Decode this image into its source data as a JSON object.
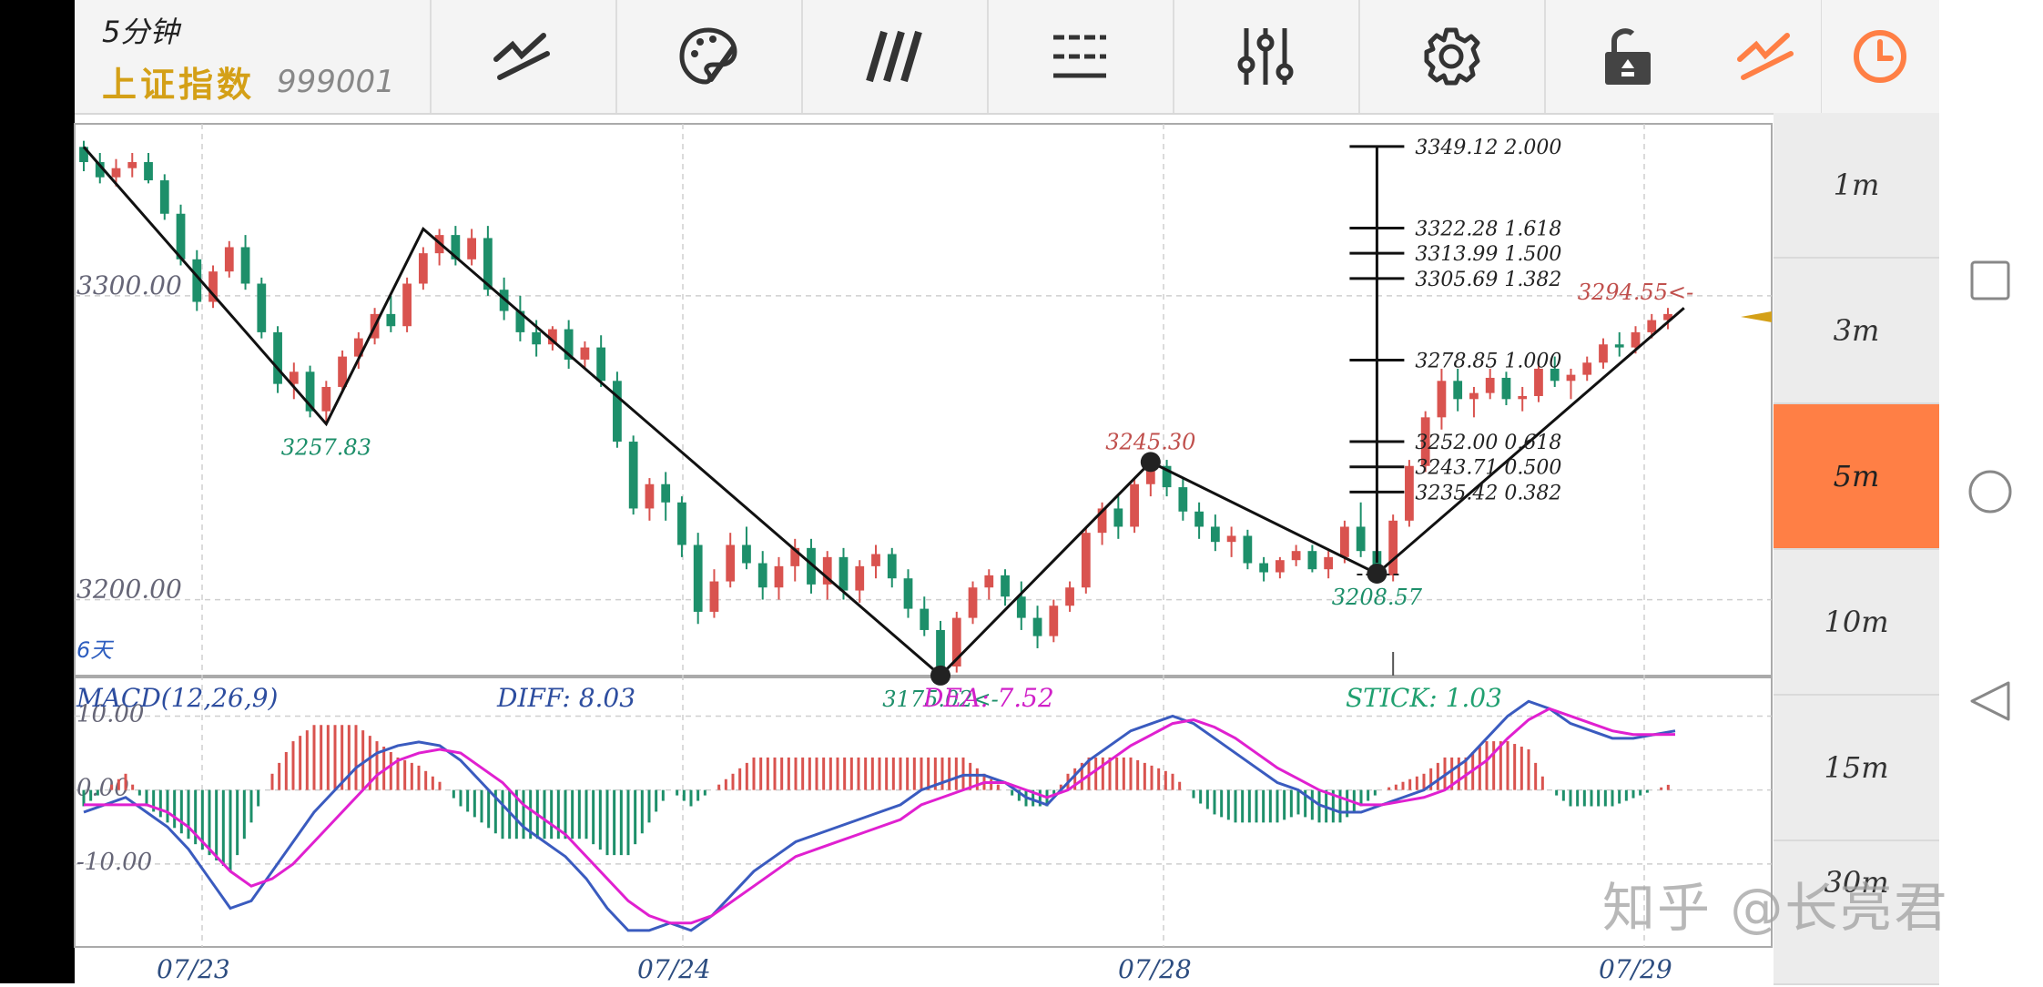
{
  "header": {
    "interval_label": "5分钟",
    "index_name": "上证指数",
    "index_code": "999001"
  },
  "toolbar": [
    {
      "name": "trend-line-tool",
      "icon": "trend-line-icon"
    },
    {
      "name": "palette-tool",
      "icon": "palette-icon"
    },
    {
      "name": "parallel-lines-tool",
      "icon": "parallel-lines-icon"
    },
    {
      "name": "horizontal-lines-tool",
      "icon": "horizontal-lines-icon"
    },
    {
      "name": "sliders-tool",
      "icon": "sliders-icon"
    },
    {
      "name": "settings-tool",
      "icon": "gear-icon"
    },
    {
      "name": "lock-tool",
      "icon": "unlock-icon"
    },
    {
      "name": "active-line-tool",
      "icon": "trend-line-icon"
    },
    {
      "name": "history-tool",
      "icon": "clock-icon"
    }
  ],
  "accent_color": "#ff7f45",
  "periods": [
    {
      "label": "1m",
      "active": false
    },
    {
      "label": "3m",
      "active": false
    },
    {
      "label": "5m",
      "active": true
    },
    {
      "label": "10m",
      "active": false
    },
    {
      "label": "15m",
      "active": false
    },
    {
      "label": "30m",
      "active": false
    }
  ],
  "watermark": "知乎 @长亮君",
  "chart_data": {
    "type": "candlestick",
    "x_tick_labels": [
      "07/23",
      "07/24",
      "07/28",
      "07/29"
    ],
    "price_axis_labels": [
      "3300.00",
      "3200.00"
    ],
    "price_range": [
      3175,
      3350
    ],
    "range_label": "6天",
    "up_color": "#d9534f",
    "down_color": "#1d8f6a",
    "candles": [
      {
        "o": 3349,
        "h": 3351,
        "l": 3341,
        "c": 3344
      },
      {
        "o": 3344,
        "h": 3347,
        "l": 3337,
        "c": 3339
      },
      {
        "o": 3339,
        "h": 3345,
        "l": 3336,
        "c": 3342
      },
      {
        "o": 3342,
        "h": 3347,
        "l": 3339,
        "c": 3344
      },
      {
        "o": 3344,
        "h": 3347,
        "l": 3337,
        "c": 3338
      },
      {
        "o": 3338,
        "h": 3340,
        "l": 3325,
        "c": 3327
      },
      {
        "o": 3327,
        "h": 3330,
        "l": 3310,
        "c": 3312
      },
      {
        "o": 3312,
        "h": 3315,
        "l": 3295,
        "c": 3298
      },
      {
        "o": 3298,
        "h": 3310,
        "l": 3296,
        "c": 3308
      },
      {
        "o": 3308,
        "h": 3318,
        "l": 3306,
        "c": 3316
      },
      {
        "o": 3316,
        "h": 3320,
        "l": 3302,
        "c": 3304
      },
      {
        "o": 3304,
        "h": 3306,
        "l": 3286,
        "c": 3288
      },
      {
        "o": 3288,
        "h": 3290,
        "l": 3268,
        "c": 3271
      },
      {
        "o": 3271,
        "h": 3278,
        "l": 3266,
        "c": 3275
      },
      {
        "o": 3275,
        "h": 3277,
        "l": 3260,
        "c": 3262
      },
      {
        "o": 3262,
        "h": 3272,
        "l": 3258,
        "c": 3270
      },
      {
        "o": 3270,
        "h": 3282,
        "l": 3268,
        "c": 3280
      },
      {
        "o": 3280,
        "h": 3288,
        "l": 3276,
        "c": 3286
      },
      {
        "o": 3286,
        "h": 3296,
        "l": 3284,
        "c": 3294
      },
      {
        "o": 3294,
        "h": 3300,
        "l": 3288,
        "c": 3290
      },
      {
        "o": 3290,
        "h": 3306,
        "l": 3288,
        "c": 3304
      },
      {
        "o": 3304,
        "h": 3316,
        "l": 3302,
        "c": 3314
      },
      {
        "o": 3314,
        "h": 3322,
        "l": 3310,
        "c": 3320
      },
      {
        "o": 3320,
        "h": 3323,
        "l": 3310,
        "c": 3312
      },
      {
        "o": 3312,
        "h": 3322,
        "l": 3310,
        "c": 3319
      },
      {
        "o": 3319,
        "h": 3323,
        "l": 3300,
        "c": 3302
      },
      {
        "o": 3302,
        "h": 3306,
        "l": 3292,
        "c": 3295
      },
      {
        "o": 3295,
        "h": 3300,
        "l": 3285,
        "c": 3288
      },
      {
        "o": 3288,
        "h": 3292,
        "l": 3280,
        "c": 3284
      },
      {
        "o": 3284,
        "h": 3290,
        "l": 3282,
        "c": 3289
      },
      {
        "o": 3289,
        "h": 3292,
        "l": 3276,
        "c": 3279
      },
      {
        "o": 3279,
        "h": 3285,
        "l": 3276,
        "c": 3283
      },
      {
        "o": 3283,
        "h": 3287,
        "l": 3270,
        "c": 3272
      },
      {
        "o": 3272,
        "h": 3275,
        "l": 3250,
        "c": 3252
      },
      {
        "o": 3252,
        "h": 3254,
        "l": 3228,
        "c": 3230
      },
      {
        "o": 3230,
        "h": 3240,
        "l": 3226,
        "c": 3238
      },
      {
        "o": 3238,
        "h": 3242,
        "l": 3226,
        "c": 3232
      },
      {
        "o": 3232,
        "h": 3234,
        "l": 3214,
        "c": 3218
      },
      {
        "o": 3218,
        "h": 3222,
        "l": 3192,
        "c": 3196
      },
      {
        "o": 3196,
        "h": 3210,
        "l": 3194,
        "c": 3206
      },
      {
        "o": 3206,
        "h": 3222,
        "l": 3204,
        "c": 3218
      },
      {
        "o": 3218,
        "h": 3224,
        "l": 3210,
        "c": 3212
      },
      {
        "o": 3212,
        "h": 3216,
        "l": 3200,
        "c": 3204
      },
      {
        "o": 3204,
        "h": 3214,
        "l": 3200,
        "c": 3211
      },
      {
        "o": 3211,
        "h": 3220,
        "l": 3206,
        "c": 3217
      },
      {
        "o": 3217,
        "h": 3220,
        "l": 3202,
        "c": 3205
      },
      {
        "o": 3205,
        "h": 3216,
        "l": 3200,
        "c": 3214
      },
      {
        "o": 3214,
        "h": 3217,
        "l": 3200,
        "c": 3203
      },
      {
        "o": 3203,
        "h": 3213,
        "l": 3199,
        "c": 3211
      },
      {
        "o": 3211,
        "h": 3218,
        "l": 3207,
        "c": 3215
      },
      {
        "o": 3215,
        "h": 3217,
        "l": 3204,
        "c": 3207
      },
      {
        "o": 3207,
        "h": 3210,
        "l": 3194,
        "c": 3197
      },
      {
        "o": 3197,
        "h": 3201,
        "l": 3188,
        "c": 3190
      },
      {
        "o": 3190,
        "h": 3193,
        "l": 3176,
        "c": 3178
      },
      {
        "o": 3178,
        "h": 3196,
        "l": 3176,
        "c": 3194
      },
      {
        "o": 3194,
        "h": 3206,
        "l": 3192,
        "c": 3204
      },
      {
        "o": 3204,
        "h": 3210,
        "l": 3200,
        "c": 3208
      },
      {
        "o": 3208,
        "h": 3210,
        "l": 3198,
        "c": 3201
      },
      {
        "o": 3201,
        "h": 3206,
        "l": 3190,
        "c": 3194
      },
      {
        "o": 3194,
        "h": 3198,
        "l": 3184,
        "c": 3188
      },
      {
        "o": 3188,
        "h": 3200,
        "l": 3186,
        "c": 3198
      },
      {
        "o": 3198,
        "h": 3206,
        "l": 3196,
        "c": 3204
      },
      {
        "o": 3204,
        "h": 3224,
        "l": 3202,
        "c": 3222
      },
      {
        "o": 3222,
        "h": 3232,
        "l": 3218,
        "c": 3230
      },
      {
        "o": 3230,
        "h": 3234,
        "l": 3220,
        "c": 3224
      },
      {
        "o": 3224,
        "h": 3240,
        "l": 3222,
        "c": 3238
      },
      {
        "o": 3238,
        "h": 3247,
        "l": 3234,
        "c": 3244
      },
      {
        "o": 3244,
        "h": 3246,
        "l": 3234,
        "c": 3237
      },
      {
        "o": 3237,
        "h": 3240,
        "l": 3226,
        "c": 3229
      },
      {
        "o": 3229,
        "h": 3232,
        "l": 3220,
        "c": 3224
      },
      {
        "o": 3224,
        "h": 3228,
        "l": 3216,
        "c": 3219
      },
      {
        "o": 3219,
        "h": 3224,
        "l": 3214,
        "c": 3221
      },
      {
        "o": 3221,
        "h": 3223,
        "l": 3210,
        "c": 3212
      },
      {
        "o": 3212,
        "h": 3214,
        "l": 3206,
        "c": 3209
      },
      {
        "o": 3209,
        "h": 3214,
        "l": 3207,
        "c": 3213
      },
      {
        "o": 3213,
        "h": 3218,
        "l": 3211,
        "c": 3216
      },
      {
        "o": 3216,
        "h": 3218,
        "l": 3209,
        "c": 3210
      },
      {
        "o": 3210,
        "h": 3216,
        "l": 3207,
        "c": 3214
      },
      {
        "o": 3214,
        "h": 3226,
        "l": 3212,
        "c": 3224
      },
      {
        "o": 3224,
        "h": 3232,
        "l": 3214,
        "c": 3216
      },
      {
        "o": 3216,
        "h": 3218,
        "l": 3206,
        "c": 3208
      },
      {
        "o": 3208,
        "h": 3228,
        "l": 3206,
        "c": 3226
      },
      {
        "o": 3226,
        "h": 3246,
        "l": 3224,
        "c": 3244
      },
      {
        "o": 3244,
        "h": 3262,
        "l": 3242,
        "c": 3260
      },
      {
        "o": 3260,
        "h": 3276,
        "l": 3256,
        "c": 3272
      },
      {
        "o": 3272,
        "h": 3276,
        "l": 3262,
        "c": 3266
      },
      {
        "o": 3266,
        "h": 3270,
        "l": 3260,
        "c": 3268
      },
      {
        "o": 3268,
        "h": 3276,
        "l": 3266,
        "c": 3273
      },
      {
        "o": 3273,
        "h": 3275,
        "l": 3264,
        "c": 3266
      },
      {
        "o": 3266,
        "h": 3270,
        "l": 3262,
        "c": 3267
      },
      {
        "o": 3267,
        "h": 3278,
        "l": 3265,
        "c": 3276
      },
      {
        "o": 3276,
        "h": 3280,
        "l": 3270,
        "c": 3272
      },
      {
        "o": 3272,
        "h": 3276,
        "l": 3266,
        "c": 3274
      },
      {
        "o": 3274,
        "h": 3280,
        "l": 3272,
        "c": 3278
      },
      {
        "o": 3278,
        "h": 3286,
        "l": 3276,
        "c": 3284
      },
      {
        "o": 3284,
        "h": 3288,
        "l": 3280,
        "c": 3283
      },
      {
        "o": 3283,
        "h": 3290,
        "l": 3281,
        "c": 3288
      },
      {
        "o": 3288,
        "h": 3294,
        "l": 3286,
        "c": 3292
      },
      {
        "o": 3292,
        "h": 3296,
        "l": 3289,
        "c": 3294
      }
    ],
    "zigzag_points": [
      {
        "i": 0,
        "price": 3349
      },
      {
        "i": 15,
        "price": 3257.83
      },
      {
        "i": 21,
        "price": 3322
      },
      {
        "i": 53,
        "price": 3175.02
      },
      {
        "i": 66,
        "price": 3245.3
      },
      {
        "i": 80,
        "price": 3208.57
      },
      {
        "i": 99,
        "price": 3296
      }
    ],
    "pivot_labels": [
      {
        "i": 15,
        "price": 3257.83,
        "text": "3257.83",
        "color": "#1d8f6a",
        "pos": "below"
      },
      {
        "i": 53,
        "price": 3175.02,
        "text": "3175.02<-",
        "color": "#1d8f6a",
        "pos": "below"
      },
      {
        "i": 66,
        "price": 3245.3,
        "text": "3245.30",
        "color": "#c0504d",
        "pos": "above"
      },
      {
        "i": 80,
        "price": 3208.57,
        "text": "3208.57",
        "color": "#1d8f6a",
        "pos": "below"
      },
      {
        "i": 96,
        "price": 3294.55,
        "text": "3294.55<-",
        "color": "#c0504d",
        "pos": "above"
      }
    ],
    "fibonacci": {
      "levels": [
        {
          "price": 3349.12,
          "ratio": "2.000"
        },
        {
          "price": 3322.28,
          "ratio": "1.618"
        },
        {
          "price": 3313.99,
          "ratio": "1.500"
        },
        {
          "price": 3305.69,
          "ratio": "1.382"
        },
        {
          "price": 3278.85,
          "ratio": "1.000"
        },
        {
          "price": 3252.0,
          "ratio": "0.618"
        },
        {
          "price": 3243.71,
          "ratio": "0.500"
        },
        {
          "price": 3235.42,
          "ratio": "0.382"
        }
      ]
    },
    "macd": {
      "label": "MACD(12,26,9)",
      "diff_label": "DIFF: 8.03",
      "dea_label": "DEA: 7.52",
      "stick_label": "STICK: 1.03",
      "axis_labels": [
        "10.00",
        "0.00",
        "-10.00"
      ],
      "range": [
        -20,
        14
      ],
      "diff_color": "#3a5bbf",
      "dea_color": "#e020d0",
      "diff": [
        -3,
        -2,
        -1,
        -3,
        -5,
        -8,
        -12,
        -16,
        -15,
        -11,
        -7,
        -3,
        0,
        3,
        5,
        6,
        6.5,
        6,
        4,
        1,
        -2,
        -5,
        -7,
        -9,
        -12,
        -16,
        -19,
        -19,
        -18,
        -19,
        -17,
        -14,
        -11,
        -9,
        -7,
        -6,
        -5,
        -4,
        -3,
        -2,
        0,
        1,
        2,
        2,
        1,
        -1,
        -2,
        1,
        4,
        6,
        8,
        9,
        10,
        9,
        7,
        5,
        3,
        1,
        0,
        -2,
        -3,
        -3,
        -2,
        -1,
        0,
        2,
        4,
        7,
        10,
        12,
        11,
        9,
        8,
        7,
        7,
        7.5,
        8
      ],
      "dea": [
        -2,
        -2,
        -2,
        -2,
        -3,
        -5,
        -8,
        -11,
        -13,
        -12,
        -10,
        -7,
        -4,
        -1,
        2,
        4,
        5,
        5.5,
        5,
        3,
        1,
        -2,
        -4,
        -6,
        -9,
        -12,
        -15,
        -17,
        -18,
        -18,
        -17,
        -15,
        -13,
        -11,
        -9,
        -8,
        -7,
        -6,
        -5,
        -4,
        -2,
        -1,
        0,
        1,
        1,
        0,
        -1,
        0,
        2,
        4,
        6,
        7.5,
        9,
        9.5,
        8.5,
        7,
        5,
        3,
        1.5,
        0,
        -1,
        -2,
        -2,
        -1.5,
        -1,
        0,
        2,
        4,
        7,
        9.5,
        11,
        10,
        9,
        8,
        7.5,
        7.5,
        7.52
      ]
    }
  }
}
